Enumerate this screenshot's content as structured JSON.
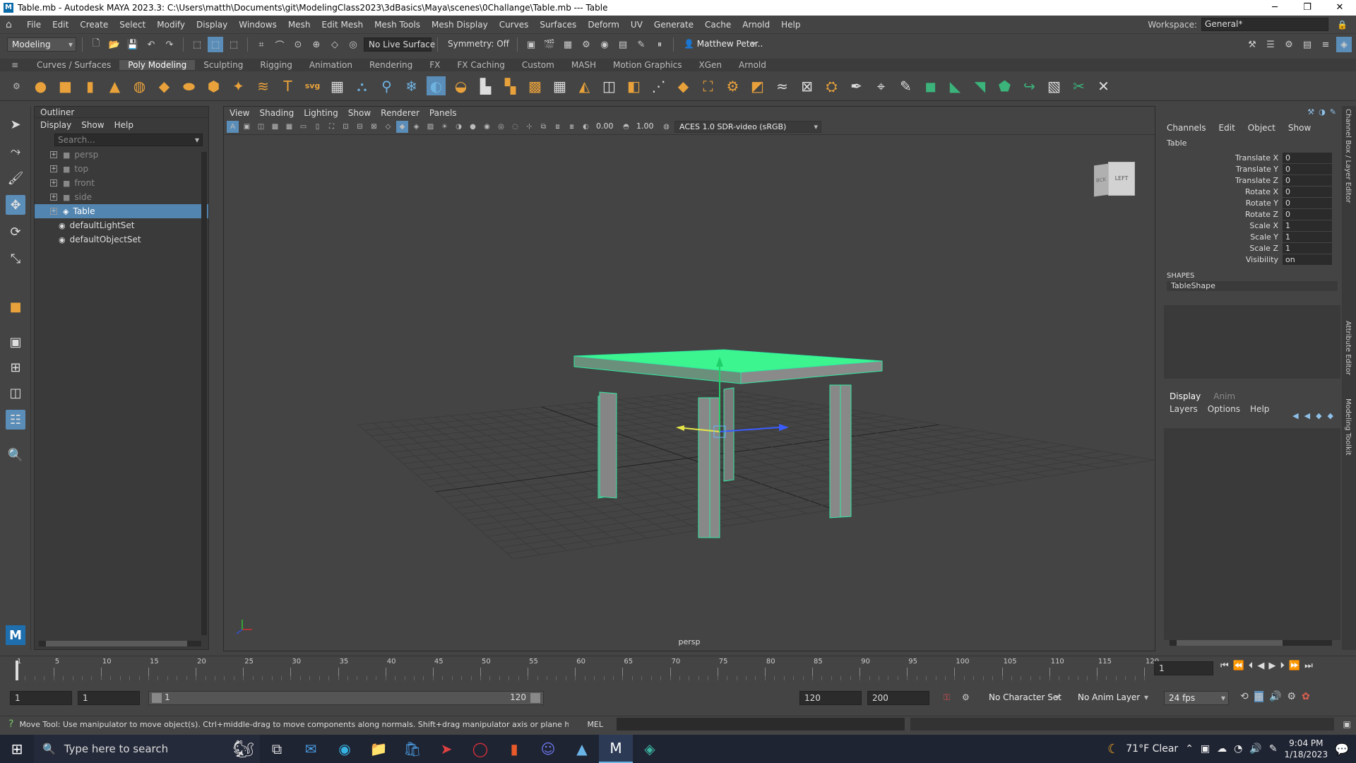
{
  "window": {
    "title": "Table.mb - Autodesk MAYA 2023.3: C:\\Users\\matth\\Documents\\git\\ModelingClass2023\\3dBasics\\Maya\\scenes\\0Challange\\Table.mb  ---  Table"
  },
  "menubar": {
    "items": [
      "File",
      "Edit",
      "Create",
      "Select",
      "Modify",
      "Display",
      "Windows",
      "Mesh",
      "Edit Mesh",
      "Mesh Tools",
      "Mesh Display",
      "Curves",
      "Surfaces",
      "Deform",
      "UV",
      "Generate",
      "Cache",
      "Arnold",
      "Help"
    ],
    "workspace_label": "Workspace:",
    "workspace_value": "General*"
  },
  "statusline": {
    "mode": "Modeling",
    "live_surface": "No Live Surface",
    "symmetry": "Symmetry: Off",
    "user": "Matthew Peter.."
  },
  "shelf": {
    "tabs": [
      "Curves / Surfaces",
      "Poly Modeling",
      "Sculpting",
      "Rigging",
      "Animation",
      "Rendering",
      "FX",
      "FX Caching",
      "Custom",
      "MASH",
      "Motion Graphics",
      "XGen",
      "Arnold"
    ],
    "active_tab": "Poly Modeling"
  },
  "outliner": {
    "title": "Outliner",
    "menus": [
      "Display",
      "Show",
      "Help"
    ],
    "search_placeholder": "Search...",
    "items": [
      {
        "label": "persp",
        "type": "camera",
        "dim": true
      },
      {
        "label": "top",
        "type": "camera",
        "dim": true
      },
      {
        "label": "front",
        "type": "camera",
        "dim": true
      },
      {
        "label": "side",
        "type": "camera",
        "dim": true
      },
      {
        "label": "Table",
        "type": "mesh",
        "selected": true
      },
      {
        "label": "defaultLightSet",
        "type": "set"
      },
      {
        "label": "defaultObjectSet",
        "type": "set"
      }
    ]
  },
  "viewport": {
    "menus": [
      "View",
      "Shading",
      "Lighting",
      "Show",
      "Renderer",
      "Panels"
    ],
    "exposure": "0.00",
    "gamma": "1.00",
    "colorspace": "ACES 1.0 SDR-video (sRGB)",
    "camera_label": "persp",
    "viewcube_left": "LEFT",
    "viewcube_back": "BCK"
  },
  "channelbox": {
    "menus": [
      "Channels",
      "Edit",
      "Object",
      "Show"
    ],
    "object": "Table",
    "channels": [
      {
        "label": "Translate X",
        "value": "0"
      },
      {
        "label": "Translate Y",
        "value": "0"
      },
      {
        "label": "Translate Z",
        "value": "0"
      },
      {
        "label": "Rotate X",
        "value": "0"
      },
      {
        "label": "Rotate Y",
        "value": "0"
      },
      {
        "label": "Rotate Z",
        "value": "0"
      },
      {
        "label": "Scale X",
        "value": "1"
      },
      {
        "label": "Scale Y",
        "value": "1"
      },
      {
        "label": "Scale Z",
        "value": "1"
      },
      {
        "label": "Visibility",
        "value": "on"
      }
    ],
    "shapes_header": "SHAPES",
    "shape": "TableShape",
    "layer_tabs": [
      "Display",
      "Anim"
    ],
    "layer_menus": [
      "Layers",
      "Options",
      "Help"
    ]
  },
  "rightstrip": {
    "labels": [
      "Channel Box / Layer Editor",
      "Attribute Editor",
      "Modeling Toolkit"
    ]
  },
  "timeslider": {
    "ticks": [
      "1",
      "5",
      "10",
      "15",
      "20",
      "25",
      "30",
      "35",
      "40",
      "45",
      "50",
      "55",
      "60",
      "65",
      "70",
      "75",
      "80",
      "85",
      "90",
      "95",
      "100",
      "105",
      "110",
      "115",
      "120"
    ],
    "current_frame": "1"
  },
  "rangeslider": {
    "start": "1",
    "playback_start": "1",
    "range_bar_start": "1",
    "range_bar_end": "120",
    "playback_end": "120",
    "end": "200",
    "character_set": "No Character Set",
    "anim_layer": "No Anim Layer",
    "fps": "24 fps"
  },
  "helpline": {
    "message": "Move Tool: Use manipulator to move object(s). Ctrl+middle-drag to move components along normals. Shift+drag manipulator axis or plane handles to extrude components or c",
    "mel": "MEL"
  },
  "taskbar": {
    "search_placeholder": "Type here to search",
    "weather": "71°F  Clear",
    "time": "9:04 PM",
    "date": "1/18/2023"
  }
}
